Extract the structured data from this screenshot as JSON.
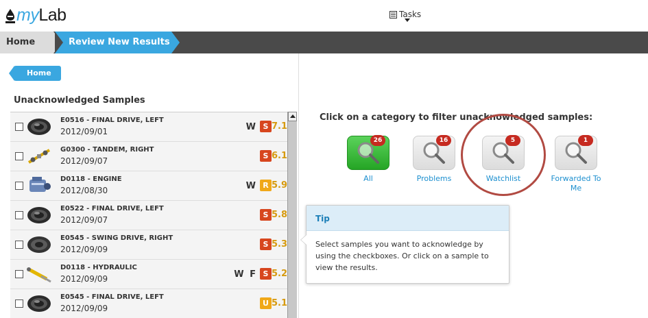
{
  "app": {
    "logo_prefix": "my",
    "logo_suffix": "Lab"
  },
  "header": {
    "tasks_label": "Tasks"
  },
  "breadcrumb": {
    "home": "Home",
    "current": "Review New Results"
  },
  "left": {
    "home_button": "Home",
    "section_title": "Unacknowledged Samples",
    "samples": [
      {
        "name": "E0516 - FINAL DRIVE, LEFT",
        "date": "2012/09/01",
        "flags": "W",
        "badge": "S",
        "badge_color": "#d7461e",
        "score": "7.1",
        "icon": "final-drive-icon"
      },
      {
        "name": "G0300 - TANDEM, RIGHT",
        "date": "2012/09/07",
        "flags": "",
        "badge": "S",
        "badge_color": "#d7461e",
        "score": "6.1",
        "icon": "tandem-icon"
      },
      {
        "name": "D0118 - ENGINE",
        "date": "2012/08/30",
        "flags": "W",
        "badge": "R",
        "badge_color": "#f0a818",
        "score": "5.9",
        "icon": "engine-icon"
      },
      {
        "name": "E0522 - FINAL DRIVE, LEFT",
        "date": "2012/09/07",
        "flags": "",
        "badge": "S",
        "badge_color": "#d7461e",
        "score": "5.8",
        "icon": "final-drive-icon"
      },
      {
        "name": "E0545 - SWING DRIVE, RIGHT",
        "date": "2012/09/09",
        "flags": "",
        "badge": "S",
        "badge_color": "#d7461e",
        "score": "5.3",
        "icon": "swing-drive-icon"
      },
      {
        "name": "D0118 - HYDRAULIC",
        "date": "2012/09/09",
        "flags": "W F",
        "badge": "S",
        "badge_color": "#d7461e",
        "score": "5.2",
        "icon": "hydraulic-icon"
      },
      {
        "name": "E0545 - FINAL DRIVE, LEFT",
        "date": "2012/09/09",
        "flags": "",
        "badge": "U",
        "badge_color": "#f0a818",
        "score": "5.1",
        "icon": "final-drive-icon"
      }
    ]
  },
  "right": {
    "instruction": "Click on a category to filter unacknowledged samples:",
    "categories": [
      {
        "label": "All",
        "count": "26",
        "icon": "magnifier-icon",
        "style": "green"
      },
      {
        "label": "Problems",
        "count": "16",
        "icon": "magnifier-icon",
        "style": "gray"
      },
      {
        "label": "Watchlist",
        "count": "5",
        "icon": "magnifier-icon",
        "style": "gray",
        "highlighted": true
      },
      {
        "label": "Forwarded To Me",
        "count": "1",
        "icon": "magnifier-icon",
        "style": "gray"
      }
    ],
    "tip": {
      "title": "Tip",
      "body": "Select samples you want to acknowledge by using the checkboxes. Or click on a sample to view the results."
    }
  },
  "colors": {
    "accent": "#3aa7e0",
    "bar": "#4a4a4a",
    "badge_red": "#c62a20",
    "highlight_ring": "#b14a42"
  }
}
